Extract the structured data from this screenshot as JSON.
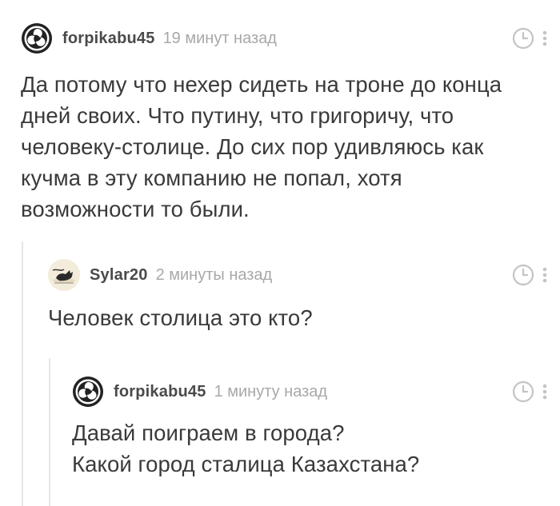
{
  "comments": [
    {
      "username": "forpikabu45",
      "time": "19 минут назад",
      "avatar_icon": "yin-yang-triskelion-icon",
      "text": "Да потому что нехер сидеть на троне до конца\nдней своих. Что путину, что григоричу, что\nчеловеку-столице. До сих пор удивляюсь как\nкучма в эту компанию не попал, хотя\nвозможности то были."
    },
    {
      "username": "Sylar20",
      "time": "2 минуты назад",
      "avatar_icon": "cat-avatar-icon",
      "text": "Человек столица это кто?"
    },
    {
      "username": "forpikabu45",
      "time": "1 минуту назад",
      "avatar_icon": "yin-yang-triskelion-icon",
      "text": "Давай поиграем в города?\nКакой город сталица Казахстана?"
    }
  ],
  "colors": {
    "text": "#3a3a3a",
    "username": "#4a4a4a",
    "time": "#a8a8a8",
    "icons": "#c4c4c4",
    "thread_line": "#e6e6e6"
  }
}
